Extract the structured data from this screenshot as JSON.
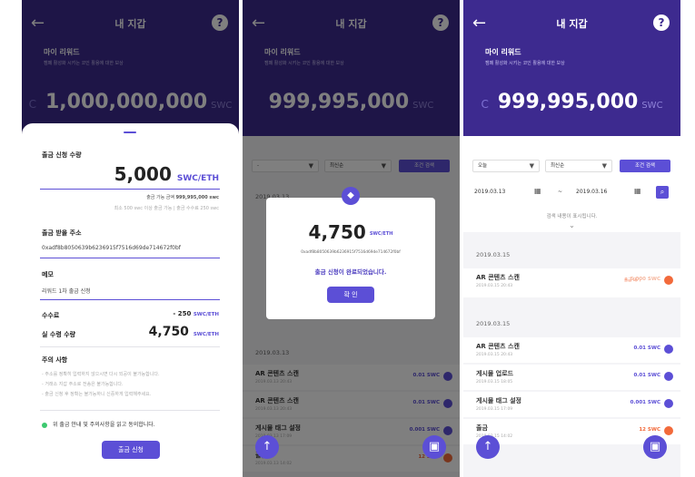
{
  "common": {
    "title": "내 지갑",
    "reward_label": "마이 리워드",
    "reward_sub": "캠페 활성화 시키는 코인 활용에 대한 보상",
    "unit": "SWC",
    "help": "?",
    "back": "←"
  },
  "screen1": {
    "balance": "1,000,000,000",
    "request_label": "출금 신청 수량",
    "request_amount": "5,000",
    "request_unit": "SWC/ETH",
    "avail_label": "출금 가능 금액",
    "avail_value": "999,995,000 swc",
    "min_note": "최소 500 swc 이상 출금 가능 | 출금 수수료 250 swc",
    "addr_label": "출금 받을 주소",
    "addr_value": "0xadf8b8050639b6236915f7516d69de714672f0bf",
    "memo_label": "메모",
    "memo_value": "리워드 1차 출금 신청",
    "fee_label": "수수료",
    "fee_value": "- 250",
    "fee_unit": "SWC/ETH",
    "actual_label": "실 수령 수량",
    "actual_value": "4,750",
    "actual_unit": "SWC/ETH",
    "notice_label": "주의 사항",
    "notices": [
      "주소를 정확히 입력하지 않으시면 다시 되공이 불가능합니다.",
      "거래소 지갑 주소로 전송은 불가능합니다.",
      "출금 신청 후 정확는 불가능하니 신중하게 입력해주세요."
    ],
    "agree": "위 출금 안내 및 주의사항을 읽고 동의합니다.",
    "submit": "출금 신청"
  },
  "screen2": {
    "balance": "999,995,000",
    "filter_period": "-",
    "filter_sort": "최신순",
    "filter_btn": "조건 검색",
    "modal_amount": "4,750",
    "modal_unit": "SWC/ETH",
    "modal_addr": "0xadf8b8050639b6236915f7516d69de714672f0bf",
    "modal_msg": "출금 신청이 완료되었습니다.",
    "modal_btn": "확 인",
    "section": "2019.03.13",
    "bg_rows": [
      {
        "title": "AR 콘텐츠 스캔",
        "date": "2019.03.13 20:43",
        "amount": "0.01 SWC"
      },
      {
        "title": "AR 콘텐츠 스캔",
        "date": "2019.03.13 20:43",
        "amount": "0.01 SWC"
      },
      {
        "title": "게시물 태그 설정",
        "date": "2019.03.13 17:09",
        "amount": "0.001 SWC"
      },
      {
        "title": "출금",
        "date": "2019.03.13 14:02",
        "amount": "12 SWC"
      }
    ]
  },
  "screen3": {
    "balance": "999,995,000",
    "filter_period": "오늘",
    "filter_sort": "최신순",
    "filter_btn": "조건 검색",
    "date_from": "2019.03.13",
    "date_sep": "~",
    "date_to": "2019.03.16",
    "empty": "검색 내용이 표시됩니다.",
    "section1": "2019.03.15",
    "row0": {
      "title": "AR 콘텐츠 스캔",
      "date": "2019.03.15 20:43",
      "status": "출금 대기",
      "amount": "5,000 SWC"
    },
    "section2": "2019.03.15",
    "rows": [
      {
        "title": "AR 콘텐츠 스캔",
        "date": "2019.03.15 20:43",
        "amount": "0.01 SWC"
      },
      {
        "title": "게시물 업로드",
        "date": "2019.03.15 18:05",
        "amount": "0.01 SWC"
      },
      {
        "title": "게시물 태그 설정",
        "date": "2019.03.15 17:09",
        "amount": "0.001 SWC"
      },
      {
        "title": "출금",
        "date": "2019.03.15 14:02",
        "amount": "12 SWC"
      }
    ]
  },
  "icons": {
    "scroll_top": "↑",
    "wallet": "wallet-icon",
    "eth": "ethereum-icon"
  },
  "colors": {
    "header": "#3d2a8f",
    "accent": "#5c4fd6",
    "orange": "#f26a3b",
    "green": "#3cc96f"
  }
}
